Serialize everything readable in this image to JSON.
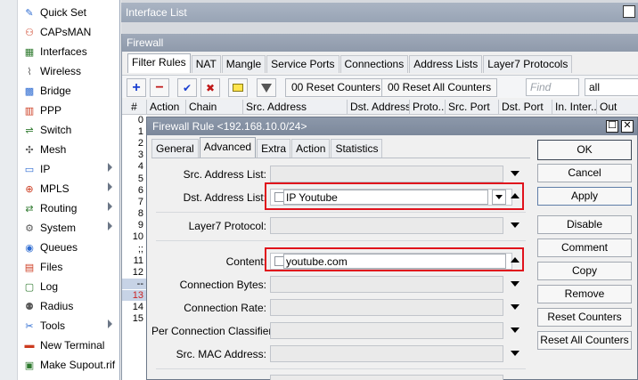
{
  "sidebar": {
    "items": [
      {
        "label": "Quick Set",
        "icon": "quick-set-icon",
        "glyph": "✎",
        "submenu": false
      },
      {
        "label": "CAPsMAN",
        "icon": "capsman-icon",
        "glyph": "⚇",
        "submenu": false
      },
      {
        "label": "Interfaces",
        "icon": "interfaces-icon",
        "glyph": "▦",
        "submenu": false
      },
      {
        "label": "Wireless",
        "icon": "wireless-icon",
        "glyph": "⌇",
        "submenu": false
      },
      {
        "label": "Bridge",
        "icon": "bridge-icon",
        "glyph": "▩",
        "submenu": false
      },
      {
        "label": "PPP",
        "icon": "ppp-icon",
        "glyph": "▥",
        "submenu": false
      },
      {
        "label": "Switch",
        "icon": "switch-icon",
        "glyph": "⇌",
        "submenu": false
      },
      {
        "label": "Mesh",
        "icon": "mesh-icon",
        "glyph": "✣",
        "submenu": false
      },
      {
        "label": "IP",
        "icon": "ip-icon",
        "glyph": "▭",
        "submenu": true
      },
      {
        "label": "MPLS",
        "icon": "mpls-icon",
        "glyph": "⊕",
        "submenu": true
      },
      {
        "label": "Routing",
        "icon": "routing-icon",
        "glyph": "⇄",
        "submenu": true
      },
      {
        "label": "System",
        "icon": "system-icon",
        "glyph": "⚙",
        "submenu": true
      },
      {
        "label": "Queues",
        "icon": "queues-icon",
        "glyph": "◉",
        "submenu": false
      },
      {
        "label": "Files",
        "icon": "files-icon",
        "glyph": "▤",
        "submenu": false
      },
      {
        "label": "Log",
        "icon": "log-icon",
        "glyph": "▢",
        "submenu": false
      },
      {
        "label": "Radius",
        "icon": "radius-icon",
        "glyph": "⚉",
        "submenu": false
      },
      {
        "label": "Tools",
        "icon": "tools-icon",
        "glyph": "✂",
        "submenu": true
      },
      {
        "label": "New Terminal",
        "icon": "terminal-icon",
        "glyph": "▬",
        "submenu": false
      },
      {
        "label": "Make Supout.rif",
        "icon": "supout-icon",
        "glyph": "▣",
        "submenu": false
      }
    ]
  },
  "interface_window": {
    "title": "Interface List"
  },
  "firewall_window": {
    "title": "Firewall",
    "tabs": [
      "Filter Rules",
      "NAT",
      "Mangle",
      "Service Ports",
      "Connections",
      "Address Lists",
      "Layer7 Protocols"
    ],
    "active_tab": "Filter Rules",
    "toolbar": {
      "reset_counters": "00 Reset Counters",
      "reset_all_counters": "00 Reset All Counters",
      "find_placeholder": "Find",
      "filter_value": "all"
    },
    "columns": [
      "#",
      "Action",
      "Chain",
      "Src. Address",
      "Dst. Address",
      "Proto...",
      "Src. Port",
      "Dst. Port",
      "In. Inter...",
      "Out"
    ],
    "row_numbers": [
      "0",
      "1",
      "2",
      "3",
      "4",
      "5",
      "6",
      "7",
      "8",
      "9",
      "10",
      ";;",
      "11",
      "12",
      "--",
      "13",
      "14",
      "15"
    ]
  },
  "rule_dialog": {
    "title": "Firewall Rule <192.168.10.0/24>",
    "tabs": [
      "General",
      "Advanced",
      "Extra",
      "Action",
      "Statistics"
    ],
    "active_tab": "Advanced",
    "fields": {
      "src_address_list": "Src. Address List:",
      "dst_address_list": "Dst. Address List:",
      "dst_address_list_value": "IP Youtube",
      "layer7_protocol": "Layer7 Protocol:",
      "content": "Content:",
      "content_value": "youtube.com",
      "connection_bytes": "Connection Bytes:",
      "connection_rate": "Connection Rate:",
      "per_connection_classifier": "Per Connection Classifier:",
      "src_mac_address": "Src. MAC Address:"
    },
    "buttons": {
      "ok": "OK",
      "cancel": "Cancel",
      "apply": "Apply",
      "disable": "Disable",
      "comment": "Comment",
      "copy": "Copy",
      "remove": "Remove",
      "reset_counters": "Reset Counters",
      "reset_all_counters": "Reset All Counters"
    },
    "max_glyph": "☐",
    "close_glyph": "✕"
  },
  "colors": {
    "highlight": "#e0121c",
    "title_bar": "#8c98aa"
  }
}
